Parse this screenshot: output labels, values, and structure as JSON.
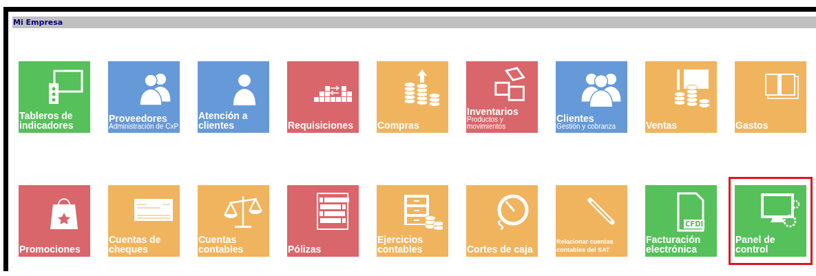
{
  "window": {
    "title": "Mi Empresa"
  },
  "tiles": [
    {
      "title": "Tableros de indicadores",
      "color": "#56c05a",
      "selected": false
    },
    {
      "title": "Proveedores",
      "subtitle": "Administración de CxP",
      "color": "#6699d8",
      "selected": false
    },
    {
      "title": "Atención a clientes",
      "color": "#6699d8",
      "selected": false
    },
    {
      "title": "Requisiciones",
      "color": "#d9666a",
      "selected": false
    },
    {
      "title": "Compras",
      "color": "#f0b45e",
      "selected": false
    },
    {
      "title": "Inventarios",
      "subtitle": "Productos y movimientos",
      "color": "#d9666a",
      "selected": false
    },
    {
      "title": "Clientes",
      "subtitle": "Gestión y cobranza",
      "color": "#6699d8",
      "selected": false
    },
    {
      "title": "Ventas",
      "color": "#f0b45e",
      "selected": false
    },
    {
      "title": "Gastos",
      "color": "#f0b45e",
      "selected": false
    },
    {
      "title": "Promociones",
      "color": "#d9666a",
      "selected": false
    },
    {
      "title": "Cuentas de cheques",
      "color": "#f0b45e",
      "selected": false
    },
    {
      "title": "Cuentas contables",
      "color": "#f0b45e",
      "selected": false
    },
    {
      "title": "Pólizas",
      "color": "#d9666a",
      "selected": false
    },
    {
      "title": "Ejercicios contables",
      "color": "#f0b45e",
      "selected": false
    },
    {
      "title": "Cortes de caja",
      "color": "#f0b45e",
      "selected": false
    },
    {
      "title": "Relacionar cuentas contables del SAT",
      "kind": "small",
      "color": "#f0b45e",
      "selected": false
    },
    {
      "title": "Facturación electrónica",
      "icon_text": "CFDI",
      "color": "#56c05a",
      "selected": false
    },
    {
      "title": "Panel de control",
      "color": "#56c05a",
      "selected": true
    }
  ]
}
